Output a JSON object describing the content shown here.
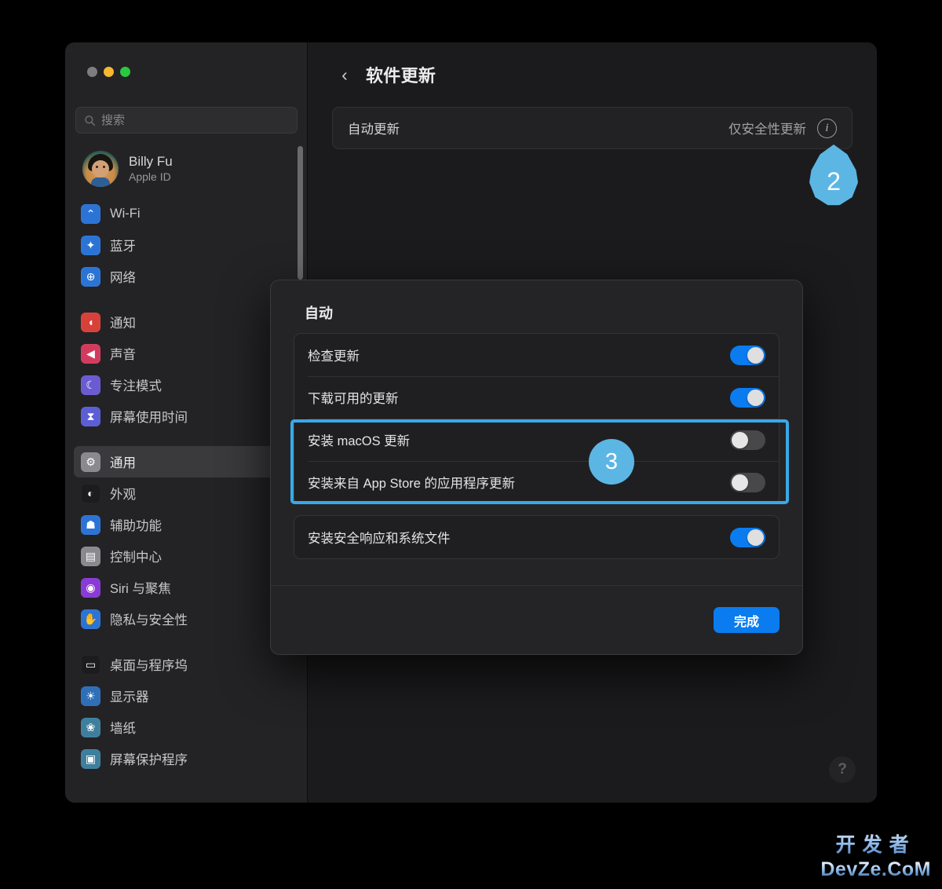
{
  "window": {
    "traffic_lights": [
      "close",
      "minimize",
      "zoom"
    ]
  },
  "sidebar": {
    "search": {
      "placeholder": "搜索",
      "value": ""
    },
    "account": {
      "name": "Billy Fu",
      "subtitle": "Apple ID"
    },
    "groups": [
      {
        "items": [
          {
            "label": "Wi-Fi",
            "icon": "wifi-icon",
            "color": "#2b74d6",
            "glyph": "⌃",
            "selected": false
          },
          {
            "label": "蓝牙",
            "icon": "bluetooth-icon",
            "color": "#2b74d6",
            "glyph": "✦",
            "selected": false
          },
          {
            "label": "网络",
            "icon": "network-icon",
            "color": "#2b74d6",
            "glyph": "⊕",
            "selected": false
          }
        ]
      },
      {
        "items": [
          {
            "label": "通知",
            "icon": "notifications-icon",
            "color": "#d8413a",
            "glyph": "◖",
            "selected": false
          },
          {
            "label": "声音",
            "icon": "sound-icon",
            "color": "#d33b5e",
            "glyph": "◀",
            "selected": false
          },
          {
            "label": "专注模式",
            "icon": "focus-icon",
            "color": "#6b5bd2",
            "glyph": "☾",
            "selected": false
          },
          {
            "label": "屏幕使用时间",
            "icon": "screen-time-icon",
            "color": "#5b5ed6",
            "glyph": "⧗",
            "selected": false
          }
        ]
      },
      {
        "items": [
          {
            "label": "通用",
            "icon": "general-icon",
            "color": "#8a8a8e",
            "glyph": "⚙",
            "selected": true
          },
          {
            "label": "外观",
            "icon": "appearance-icon",
            "color": "#1c1c1e",
            "glyph": "◐",
            "selected": false
          },
          {
            "label": "辅助功能",
            "icon": "accessibility-icon",
            "color": "#2b74d6",
            "glyph": "☗",
            "selected": false
          },
          {
            "label": "控制中心",
            "icon": "control-center-icon",
            "color": "#8a8a8e",
            "glyph": "▤",
            "selected": false
          },
          {
            "label": "Siri 与聚焦",
            "icon": "siri-spotlight-icon",
            "color": "#8a3ad6",
            "glyph": "◉",
            "selected": false
          },
          {
            "label": "隐私与安全性",
            "icon": "privacy-security-icon",
            "color": "#2b74d6",
            "glyph": "✋",
            "selected": false
          }
        ]
      },
      {
        "items": [
          {
            "label": "桌面与程序坞",
            "icon": "desktop-dock-icon",
            "color": "#1c1c1e",
            "glyph": "▭",
            "selected": false
          },
          {
            "label": "显示器",
            "icon": "displays-icon",
            "color": "#2f6fb8",
            "glyph": "☀",
            "selected": false
          },
          {
            "label": "墙纸",
            "icon": "wallpaper-icon",
            "color": "#3f7f9e",
            "glyph": "❀",
            "selected": false
          },
          {
            "label": "屏幕保护程序",
            "icon": "screen-saver-icon",
            "color": "#3f7f9e",
            "glyph": "▣",
            "selected": false
          }
        ]
      }
    ]
  },
  "main": {
    "back_label": "‹",
    "title": "软件更新",
    "auto_update_row": {
      "label": "自动更新",
      "value": "仅安全性更新",
      "info_glyph": "i"
    },
    "help_glyph": "?"
  },
  "modal": {
    "title": "自动",
    "group_one": [
      {
        "label": "检查更新",
        "state": "on"
      },
      {
        "label": "下载可用的更新",
        "state": "on"
      },
      {
        "label": "安装 macOS 更新",
        "state": "off"
      },
      {
        "label": "安装来自 App Store 的应用程序更新",
        "state": "off"
      }
    ],
    "group_two": [
      {
        "label": "安装安全响应和系统文件",
        "state": "on"
      }
    ],
    "done_label": "完成"
  },
  "callouts": [
    {
      "number": "2",
      "shape": "teardrop",
      "color": "#5cb6e4"
    },
    {
      "number": "3",
      "shape": "circle",
      "color": "#39a8e8"
    }
  ],
  "highlight": {
    "color": "#39a8e8"
  },
  "watermark": {
    "cn": "开发者",
    "en": "DevZe.CoM"
  },
  "colors": {
    "accent": "#0a7cf0",
    "callout": "#5cb6e4",
    "toggle_on": "#0a7cf0",
    "toggle_off": "#48484a",
    "window_bg": "#1b1b1d",
    "sidebar_bg": "#232325"
  }
}
